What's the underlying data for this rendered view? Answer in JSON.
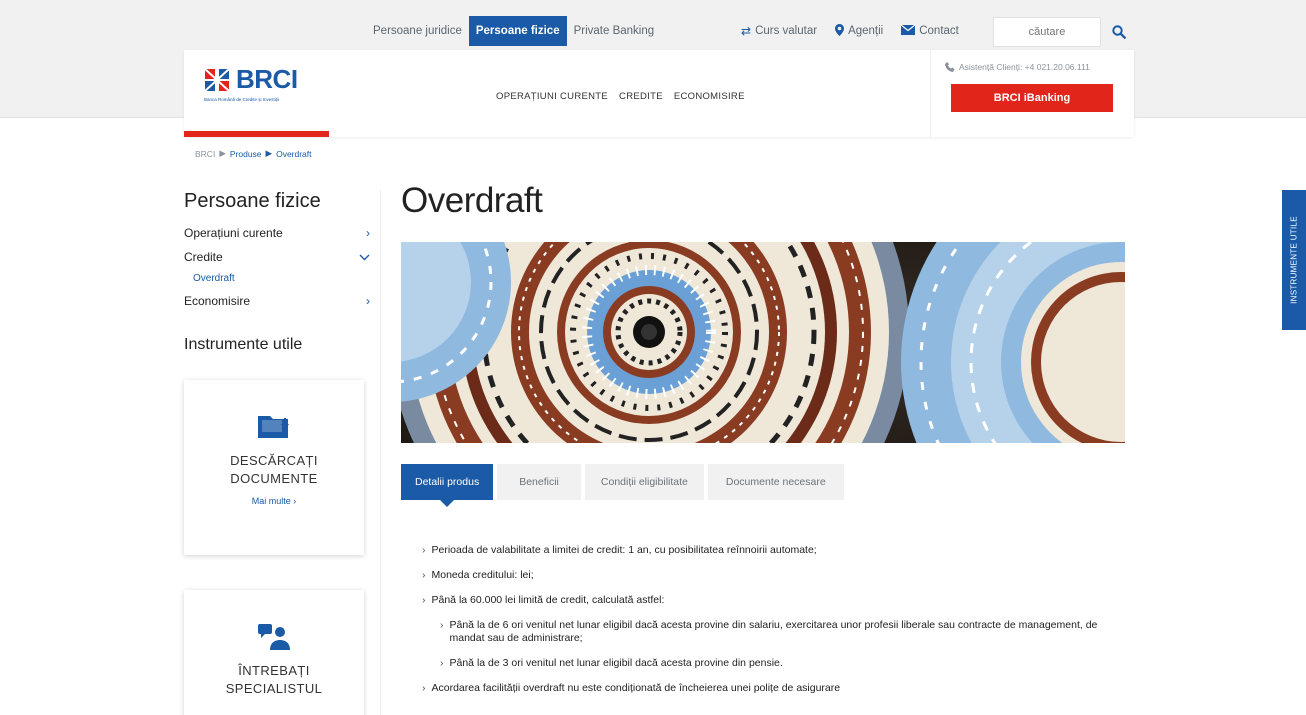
{
  "utility": {
    "tabs": [
      {
        "label": "Persoane juridice",
        "active": false
      },
      {
        "label": "Persoane fizice",
        "active": true
      },
      {
        "label": "Private Banking",
        "active": false
      }
    ],
    "curs": "Curs valutar",
    "agentii": "Agenții",
    "contact": "Contact",
    "search_placeholder": "căutare"
  },
  "header": {
    "logo_text": "BRCI",
    "logo_sub": "Banca Română de Credite și Investiții",
    "nav": [
      "OPERAȚIUNI CURENTE",
      "CREDITE",
      "ECONOMISIRE"
    ],
    "assist": "Asistență Clienți: +4 021.20.06.111",
    "ibanking": "BRCI iBanking"
  },
  "breadcrumb": [
    "BRCI",
    "Produse",
    "Overdraft"
  ],
  "sidebar": {
    "title": "Persoane fizice",
    "items": [
      {
        "label": "Operațiuni curente",
        "chev": "›"
      },
      {
        "label": "Credite",
        "chev": "⌄"
      }
    ],
    "sub": "Overdraft",
    "item_after": {
      "label": "Economisire",
      "chev": "›"
    },
    "tools_title": "Instrumente utile",
    "cards": [
      {
        "label1": "DESCĂRCAȚI",
        "label2": "DOCUMENTE",
        "more": "Mai multe ›"
      },
      {
        "label1": "ÎNTREBAȚI",
        "label2": "SPECIALISTUL"
      }
    ]
  },
  "main": {
    "title": "Overdraft",
    "tabs": [
      {
        "label": "Detalii produs",
        "active": true
      },
      {
        "label": "Beneficii",
        "active": false
      },
      {
        "label": "Condiții eligibilitate",
        "active": false
      },
      {
        "label": "Documente necesare",
        "active": false
      }
    ],
    "bullets": [
      "Perioada de valabilitate a limitei de credit: 1 an, cu posibilitatea reînnoirii automate;",
      "Moneda creditului: lei;",
      "Până la 60.000 lei limită de credit, calculată astfel:"
    ],
    "sub_bullets": [
      "Până la de 6 ori venitul net lunar eligibil dacă acesta provine din salariu, exercitarea unor profesii liberale sau contracte de management, de mandat sau de administrare;",
      "Până la de 3 ori venitul net lunar eligibil dacă acesta provine din pensie."
    ],
    "last_bullet": "Acordarea facilității overdraft nu este condiționată de încheierea unei polițe de asigurare"
  },
  "side_tab": "INSTRUMENTE UTILE",
  "colors": {
    "brand_blue": "#1a5aa6",
    "brand_red": "#e1251b"
  }
}
